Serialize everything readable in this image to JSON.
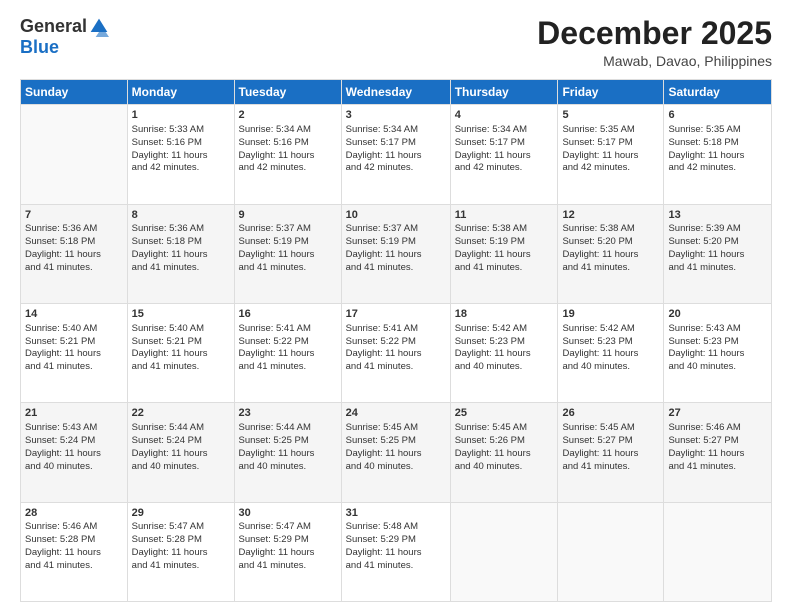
{
  "header": {
    "logo_general": "General",
    "logo_blue": "Blue",
    "month": "December 2025",
    "location": "Mawab, Davao, Philippines"
  },
  "days_of_week": [
    "Sunday",
    "Monday",
    "Tuesday",
    "Wednesday",
    "Thursday",
    "Friday",
    "Saturday"
  ],
  "weeks": [
    [
      {
        "day": "",
        "info": ""
      },
      {
        "day": "1",
        "info": "Sunrise: 5:33 AM\nSunset: 5:16 PM\nDaylight: 11 hours\nand 42 minutes."
      },
      {
        "day": "2",
        "info": "Sunrise: 5:34 AM\nSunset: 5:16 PM\nDaylight: 11 hours\nand 42 minutes."
      },
      {
        "day": "3",
        "info": "Sunrise: 5:34 AM\nSunset: 5:17 PM\nDaylight: 11 hours\nand 42 minutes."
      },
      {
        "day": "4",
        "info": "Sunrise: 5:34 AM\nSunset: 5:17 PM\nDaylight: 11 hours\nand 42 minutes."
      },
      {
        "day": "5",
        "info": "Sunrise: 5:35 AM\nSunset: 5:17 PM\nDaylight: 11 hours\nand 42 minutes."
      },
      {
        "day": "6",
        "info": "Sunrise: 5:35 AM\nSunset: 5:18 PM\nDaylight: 11 hours\nand 42 minutes."
      }
    ],
    [
      {
        "day": "7",
        "info": "Sunrise: 5:36 AM\nSunset: 5:18 PM\nDaylight: 11 hours\nand 41 minutes."
      },
      {
        "day": "8",
        "info": "Sunrise: 5:36 AM\nSunset: 5:18 PM\nDaylight: 11 hours\nand 41 minutes."
      },
      {
        "day": "9",
        "info": "Sunrise: 5:37 AM\nSunset: 5:19 PM\nDaylight: 11 hours\nand 41 minutes."
      },
      {
        "day": "10",
        "info": "Sunrise: 5:37 AM\nSunset: 5:19 PM\nDaylight: 11 hours\nand 41 minutes."
      },
      {
        "day": "11",
        "info": "Sunrise: 5:38 AM\nSunset: 5:19 PM\nDaylight: 11 hours\nand 41 minutes."
      },
      {
        "day": "12",
        "info": "Sunrise: 5:38 AM\nSunset: 5:20 PM\nDaylight: 11 hours\nand 41 minutes."
      },
      {
        "day": "13",
        "info": "Sunrise: 5:39 AM\nSunset: 5:20 PM\nDaylight: 11 hours\nand 41 minutes."
      }
    ],
    [
      {
        "day": "14",
        "info": "Sunrise: 5:40 AM\nSunset: 5:21 PM\nDaylight: 11 hours\nand 41 minutes."
      },
      {
        "day": "15",
        "info": "Sunrise: 5:40 AM\nSunset: 5:21 PM\nDaylight: 11 hours\nand 41 minutes."
      },
      {
        "day": "16",
        "info": "Sunrise: 5:41 AM\nSunset: 5:22 PM\nDaylight: 11 hours\nand 41 minutes."
      },
      {
        "day": "17",
        "info": "Sunrise: 5:41 AM\nSunset: 5:22 PM\nDaylight: 11 hours\nand 41 minutes."
      },
      {
        "day": "18",
        "info": "Sunrise: 5:42 AM\nSunset: 5:23 PM\nDaylight: 11 hours\nand 40 minutes."
      },
      {
        "day": "19",
        "info": "Sunrise: 5:42 AM\nSunset: 5:23 PM\nDaylight: 11 hours\nand 40 minutes."
      },
      {
        "day": "20",
        "info": "Sunrise: 5:43 AM\nSunset: 5:23 PM\nDaylight: 11 hours\nand 40 minutes."
      }
    ],
    [
      {
        "day": "21",
        "info": "Sunrise: 5:43 AM\nSunset: 5:24 PM\nDaylight: 11 hours\nand 40 minutes."
      },
      {
        "day": "22",
        "info": "Sunrise: 5:44 AM\nSunset: 5:24 PM\nDaylight: 11 hours\nand 40 minutes."
      },
      {
        "day": "23",
        "info": "Sunrise: 5:44 AM\nSunset: 5:25 PM\nDaylight: 11 hours\nand 40 minutes."
      },
      {
        "day": "24",
        "info": "Sunrise: 5:45 AM\nSunset: 5:25 PM\nDaylight: 11 hours\nand 40 minutes."
      },
      {
        "day": "25",
        "info": "Sunrise: 5:45 AM\nSunset: 5:26 PM\nDaylight: 11 hours\nand 40 minutes."
      },
      {
        "day": "26",
        "info": "Sunrise: 5:45 AM\nSunset: 5:27 PM\nDaylight: 11 hours\nand 41 minutes."
      },
      {
        "day": "27",
        "info": "Sunrise: 5:46 AM\nSunset: 5:27 PM\nDaylight: 11 hours\nand 41 minutes."
      }
    ],
    [
      {
        "day": "28",
        "info": "Sunrise: 5:46 AM\nSunset: 5:28 PM\nDaylight: 11 hours\nand 41 minutes."
      },
      {
        "day": "29",
        "info": "Sunrise: 5:47 AM\nSunset: 5:28 PM\nDaylight: 11 hours\nand 41 minutes."
      },
      {
        "day": "30",
        "info": "Sunrise: 5:47 AM\nSunset: 5:29 PM\nDaylight: 11 hours\nand 41 minutes."
      },
      {
        "day": "31",
        "info": "Sunrise: 5:48 AM\nSunset: 5:29 PM\nDaylight: 11 hours\nand 41 minutes."
      },
      {
        "day": "",
        "info": ""
      },
      {
        "day": "",
        "info": ""
      },
      {
        "day": "",
        "info": ""
      }
    ]
  ]
}
